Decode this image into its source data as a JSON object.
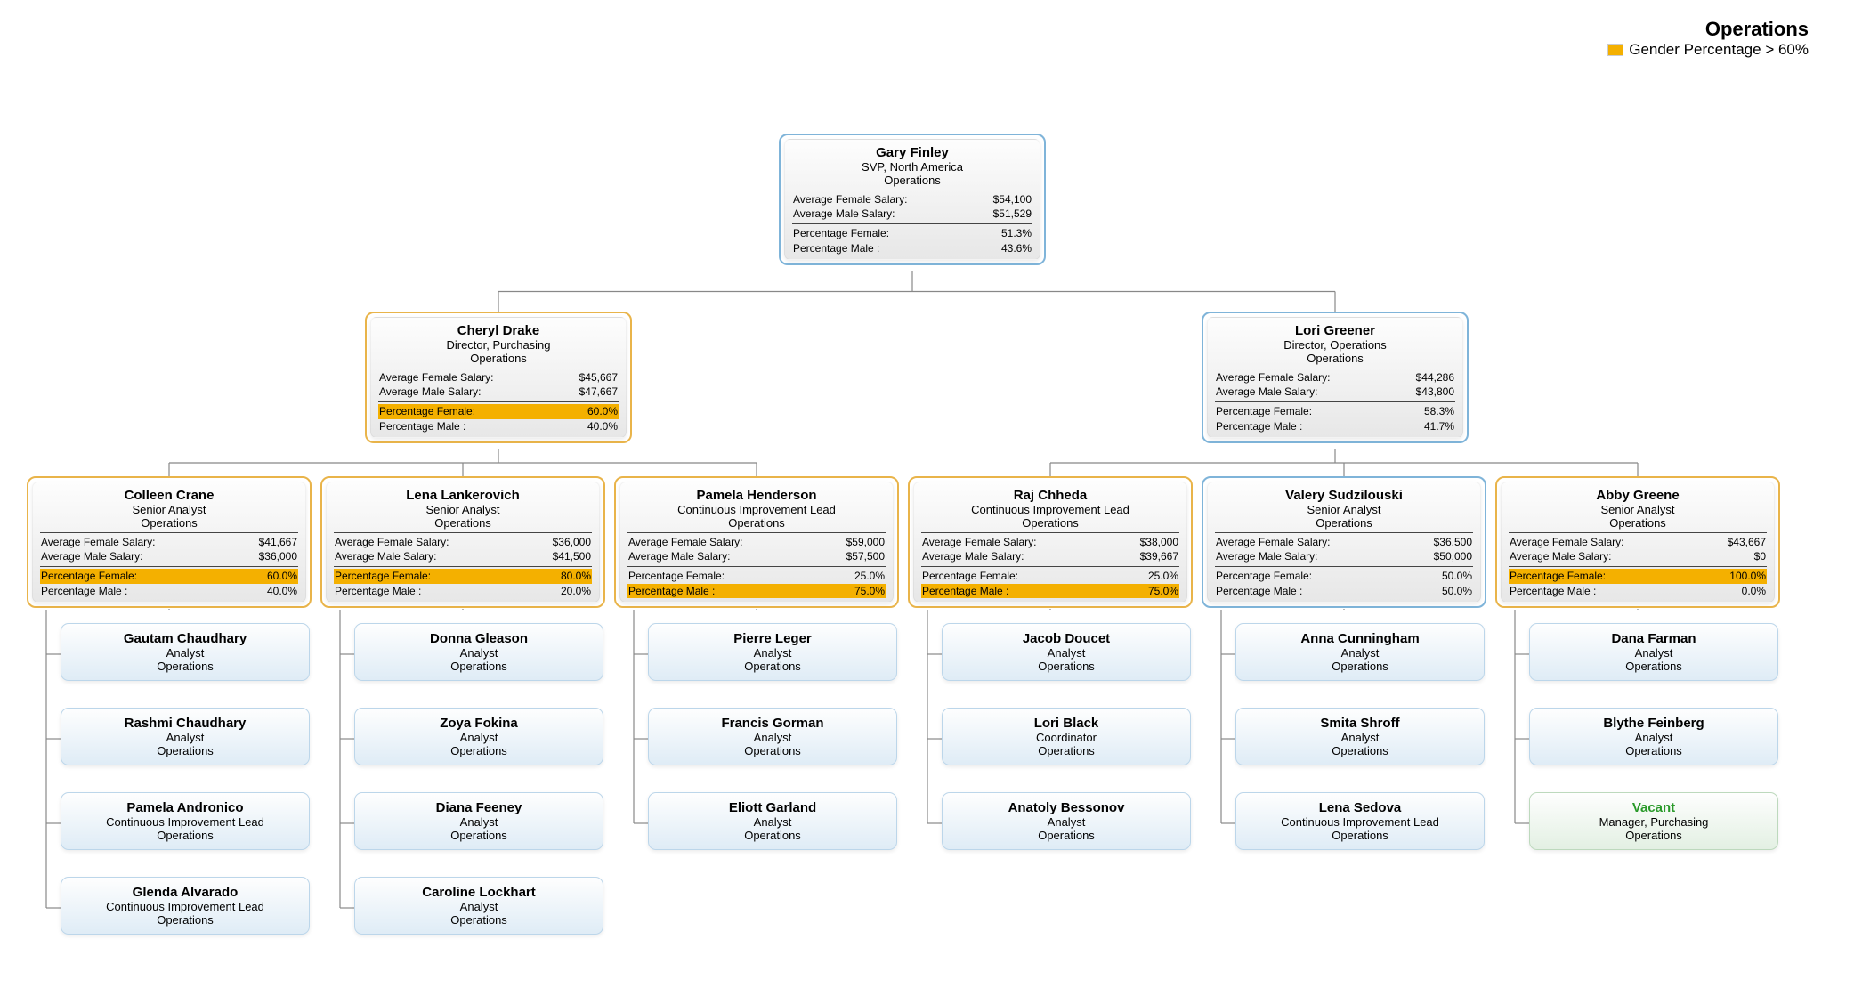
{
  "title": "Operations",
  "legend": "Gender Percentage > 60%",
  "labels": {
    "afs": "Average Female Salary:",
    "ams": "Average Male Salary:",
    "pf": "Percentage Female:",
    "pm": "Percentage Male :"
  },
  "root": {
    "name": "Gary Finley",
    "role": "SVP, North America",
    "dept": "Operations",
    "afs": "$54,100",
    "ams": "$51,529",
    "pf": "51.3%",
    "pm": "43.6%"
  },
  "level2": [
    {
      "name": "Cheryl Drake",
      "role": "Director, Purchasing",
      "dept": "Operations",
      "afs": "$45,667",
      "ams": "$47,667",
      "pf": "60.0%",
      "pm": "40.0%",
      "hl": "pf",
      "color": "amber"
    },
    {
      "name": "Lori Greener",
      "role": "Director, Operations",
      "dept": "Operations",
      "afs": "$44,286",
      "ams": "$43,800",
      "pf": "58.3%",
      "pm": "41.7%",
      "hl": "",
      "color": "blue"
    }
  ],
  "level3": [
    {
      "parent": 0,
      "name": "Colleen Crane",
      "role": "Senior Analyst",
      "dept": "Operations",
      "afs": "$41,667",
      "ams": "$36,000",
      "pf": "60.0%",
      "pm": "40.0%",
      "hl": "pf",
      "color": "amber"
    },
    {
      "parent": 0,
      "name": "Lena Lankerovich",
      "role": "Senior Analyst",
      "dept": "Operations",
      "afs": "$36,000",
      "ams": "$41,500",
      "pf": "80.0%",
      "pm": "20.0%",
      "hl": "pf",
      "color": "amber"
    },
    {
      "parent": 0,
      "name": "Pamela Henderson",
      "role": "Continuous Improvement Lead",
      "dept": "Operations",
      "afs": "$59,000",
      "ams": "$57,500",
      "pf": "25.0%",
      "pm": "75.0%",
      "hl": "pm",
      "color": "amber"
    },
    {
      "parent": 1,
      "name": "Raj Chheda",
      "role": "Continuous Improvement Lead",
      "dept": "Operations",
      "afs": "$38,000",
      "ams": "$39,667",
      "pf": "25.0%",
      "pm": "75.0%",
      "hl": "pm",
      "color": "amber"
    },
    {
      "parent": 1,
      "name": "Valery Sudzilouski",
      "role": "Senior Analyst",
      "dept": "Operations",
      "afs": "$36,500",
      "ams": "$50,000",
      "pf": "50.0%",
      "pm": "50.0%",
      "hl": "",
      "color": "blue"
    },
    {
      "parent": 1,
      "name": "Abby Greene",
      "role": "Senior Analyst",
      "dept": "Operations",
      "afs": "$43,667",
      "ams": "$0",
      "pf": "100.0%",
      "pm": "0.0%",
      "hl": "pf",
      "color": "amber"
    }
  ],
  "leaves": [
    {
      "col": 0,
      "name": "Gautam Chaudhary",
      "role": "Analyst",
      "dept": "Operations"
    },
    {
      "col": 0,
      "name": "Rashmi Chaudhary",
      "role": "Analyst",
      "dept": "Operations"
    },
    {
      "col": 0,
      "name": "Pamela Andronico",
      "role": "Continuous Improvement Lead",
      "dept": "Operations"
    },
    {
      "col": 0,
      "name": "Glenda Alvarado",
      "role": "Continuous Improvement Lead",
      "dept": "Operations"
    },
    {
      "col": 1,
      "name": "Donna Gleason",
      "role": "Analyst",
      "dept": "Operations"
    },
    {
      "col": 1,
      "name": "Zoya Fokina",
      "role": "Analyst",
      "dept": "Operations"
    },
    {
      "col": 1,
      "name": "Diana Feeney",
      "role": "Analyst",
      "dept": "Operations"
    },
    {
      "col": 1,
      "name": "Caroline Lockhart",
      "role": "Analyst",
      "dept": "Operations"
    },
    {
      "col": 2,
      "name": "Pierre Leger",
      "role": "Analyst",
      "dept": "Operations"
    },
    {
      "col": 2,
      "name": "Francis Gorman",
      "role": "Analyst",
      "dept": "Operations"
    },
    {
      "col": 2,
      "name": "Eliott Garland",
      "role": "Analyst",
      "dept": "Operations"
    },
    {
      "col": 3,
      "name": "Jacob Doucet",
      "role": "Analyst",
      "dept": "Operations"
    },
    {
      "col": 3,
      "name": "Lori Black",
      "role": "Coordinator",
      "dept": "Operations"
    },
    {
      "col": 3,
      "name": "Anatoly Bessonov",
      "role": "Analyst",
      "dept": "Operations"
    },
    {
      "col": 4,
      "name": "Anna Cunningham",
      "role": "Analyst",
      "dept": "Operations"
    },
    {
      "col": 4,
      "name": "Smita Shroff",
      "role": "Analyst",
      "dept": "Operations"
    },
    {
      "col": 4,
      "name": "Lena Sedova",
      "role": "Continuous Improvement Lead",
      "dept": "Operations"
    },
    {
      "col": 5,
      "name": "Dana Farman",
      "role": "Analyst",
      "dept": "Operations"
    },
    {
      "col": 5,
      "name": "Blythe Feinberg",
      "role": "Analyst",
      "dept": "Operations"
    },
    {
      "col": 5,
      "name": "Vacant",
      "role": "Manager, Purchasing",
      "dept": "Operations",
      "vacant": true
    }
  ],
  "layout": {
    "headerCardW": 300,
    "nodeW": 320,
    "rootTop": 150,
    "rootLeft": 875,
    "l2Top": 350,
    "l2Left": [
      410,
      1350
    ],
    "l3Top": 535,
    "l3Left": [
      30,
      360,
      690,
      1020,
      1350,
      1680
    ],
    "leafTop0": 700,
    "leafGap": 95,
    "leafW": 280
  }
}
